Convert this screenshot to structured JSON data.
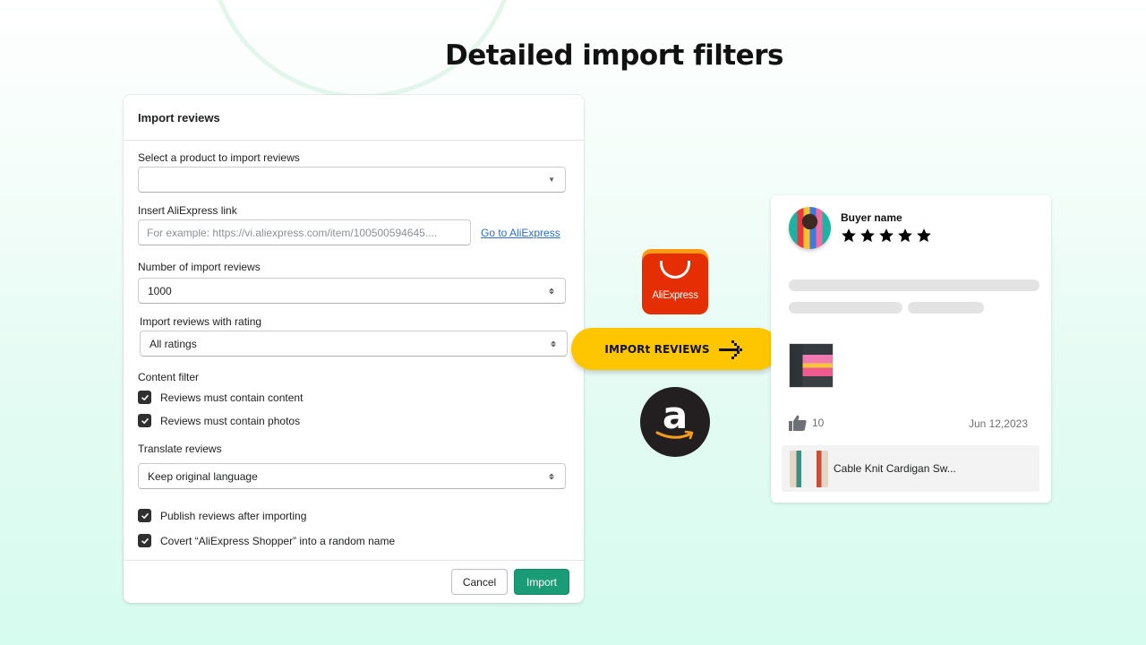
{
  "headline": "Detailed import filters",
  "modal": {
    "title": "Import reviews",
    "product_select": {
      "label": "Select a product to import reviews",
      "value": ""
    },
    "link_input": {
      "label": "Insert AliExpress link",
      "value": "",
      "placeholder": "For example: https://vi.aliexpress.com/item/100500594645....",
      "go_link": "Go to AliExpress"
    },
    "count_select": {
      "label": "Number of import reviews",
      "value": "1000"
    },
    "rating_select": {
      "label": "Import reviews with rating",
      "value": "All ratings"
    },
    "content_filter": {
      "label": "Content filter",
      "options": [
        {
          "label": "Reviews must contain content",
          "checked": true
        },
        {
          "label": "Reviews must contain photos",
          "checked": true
        }
      ]
    },
    "translate_select": {
      "label": "Translate reviews",
      "value": "Keep original language"
    },
    "extra_options": [
      {
        "label": "Publish reviews after importing",
        "checked": true
      },
      {
        "label": "Covert “AliExpress Shopper” into a random name",
        "checked": true
      }
    ],
    "footer": {
      "cancel_label": "Cancel",
      "import_label": "Import"
    }
  },
  "center": {
    "aliexpress_logo_text": "AliExpress",
    "import_button_label": "IMPORt REVIEWS",
    "amazon_logo_glyph": "a"
  },
  "review_card": {
    "buyer_name": "Buyer name",
    "rating": 5,
    "rating_max": 5,
    "likes": "10",
    "date": "Jun 12,2023",
    "product_name": "Cable Knit Cardigan Sw..."
  },
  "colors": {
    "primary_button": "#1a9c76",
    "import_pill": "#fec600",
    "aliexpress_red": "#e62e04",
    "link": "#2c6ecb"
  }
}
